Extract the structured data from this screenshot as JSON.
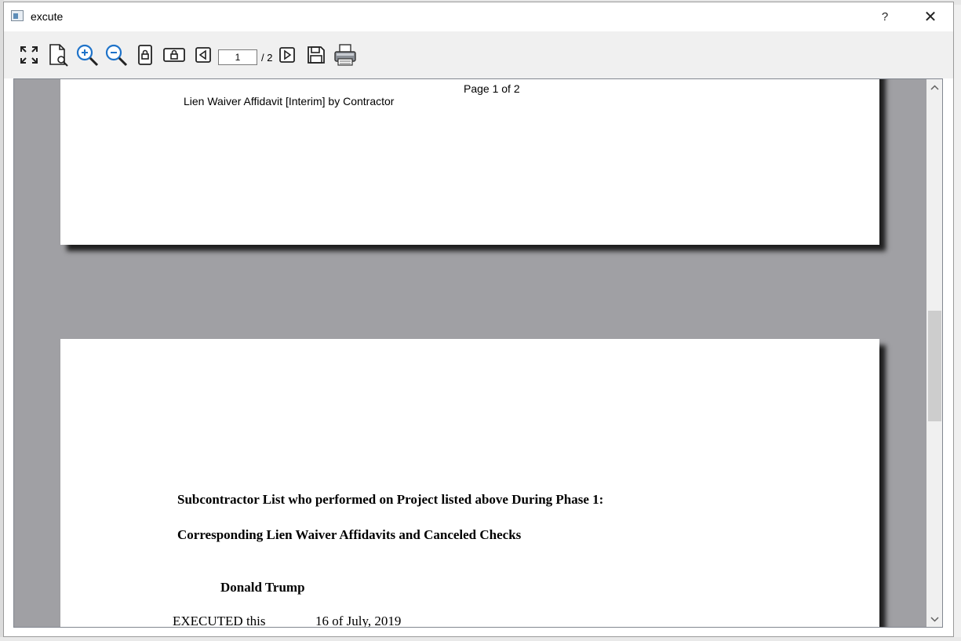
{
  "window": {
    "title": "excute",
    "help_label": "?",
    "close_label": "✕"
  },
  "toolbar": {
    "tools": [
      {
        "name": "fit-window",
        "icon": "expand-arrows-icon"
      },
      {
        "name": "page-preview",
        "icon": "page-search-icon"
      },
      {
        "name": "zoom-in",
        "icon": "zoom-in-icon"
      },
      {
        "name": "zoom-out",
        "icon": "zoom-out-icon"
      },
      {
        "name": "fit-page",
        "icon": "portrait-page-icon"
      },
      {
        "name": "fit-width",
        "icon": "landscape-page-icon"
      },
      {
        "name": "previous-page",
        "icon": "previous-page-icon"
      },
      {
        "name": "next-page",
        "icon": "next-page-icon"
      },
      {
        "name": "save",
        "icon": "floppy-disk-icon"
      },
      {
        "name": "print",
        "icon": "printer-icon"
      }
    ],
    "current_page": "1",
    "total_pages": "/ 2"
  },
  "document": {
    "page1": {
      "page_number": "Page 1 of 2",
      "header": "Lien Waiver Affidavit [Interim] by Contractor"
    },
    "page2": {
      "line1": "Subcontractor List who performed on Project listed above During Phase 1:",
      "line2": "Corresponding Lien Waiver Affidavits and Canceled Checks",
      "signer": "Donald Trump",
      "executed_label": "EXECUTED this",
      "executed_date": "16 of July, 2019"
    }
  },
  "colors": {
    "viewer_background": "#a0a0a4",
    "page_background": "#ffffff",
    "toolbar_background": "#f0f0f0",
    "icon_blue": "#1f73c9"
  }
}
